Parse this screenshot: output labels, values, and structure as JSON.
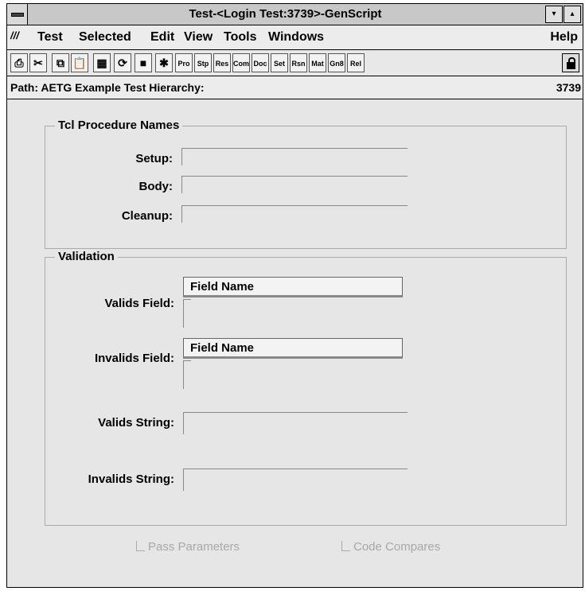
{
  "window": {
    "title": "Test-<Login Test:3739>-GenScript",
    "minimize_glyph": "▾",
    "maximize_glyph": "▴"
  },
  "menubar": {
    "logo_text": "///",
    "items": [
      "Test",
      "Selected",
      "Edit",
      "View",
      "Tools",
      "Windows"
    ],
    "help": "Help"
  },
  "toolbar": {
    "icon_buttons": [
      {
        "name": "print-icon",
        "glyph": "⎙"
      },
      {
        "name": "cut-icon",
        "glyph": "✂"
      },
      {
        "name": "copy-icon",
        "glyph": "⧉"
      },
      {
        "name": "paste-icon",
        "glyph": "📋"
      },
      {
        "name": "hierarchy-icon",
        "glyph": "▦"
      },
      {
        "name": "refresh-icon",
        "glyph": "⟳"
      },
      {
        "name": "save-icon",
        "glyph": "■"
      },
      {
        "name": "run-icon",
        "glyph": "✱"
      }
    ],
    "text_buttons": [
      "Pro",
      "Stp",
      "Res",
      "Com",
      "Doc",
      "Set",
      "Rsn",
      "Mat",
      "Gn8",
      "Rel"
    ]
  },
  "path": {
    "label": "Path: AETG Example Test Hierarchy:",
    "number": "3739"
  },
  "tcl_group": {
    "title": "Tcl Procedure Names",
    "setup_label": "Setup:",
    "body_label": "Body:",
    "cleanup_label": "Cleanup:"
  },
  "validation_group": {
    "title": "Validation",
    "valids_field_label": "Valids Field:",
    "valids_field_header": "Field Name",
    "invalids_field_label": "Invalids Field:",
    "invalids_field_header": "Field Name",
    "valids_string_label": "Valids String:",
    "invalids_string_label": "Invalids String:"
  },
  "options": {
    "pass_parameters": "Pass Parameters",
    "code_compares": "Code Compares"
  }
}
